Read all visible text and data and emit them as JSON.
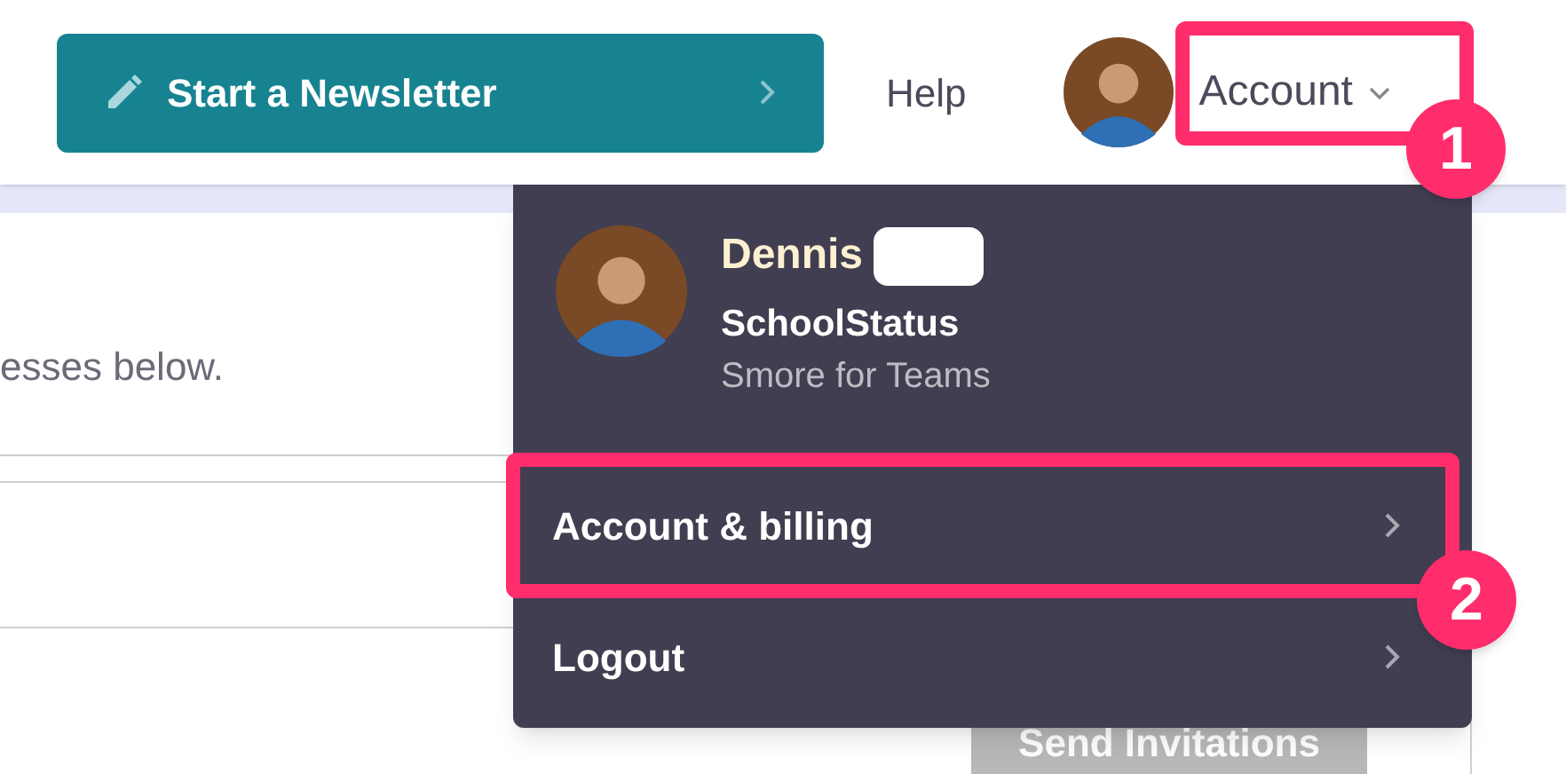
{
  "header": {
    "newsletter_button": "Start a Newsletter",
    "help_link": "Help",
    "account_menu": {
      "label": "Account",
      "expanded": true,
      "callout": "1"
    }
  },
  "page": {
    "instructions": "esses below.",
    "send_button": {
      "label": "Send Invitations",
      "disabled": true
    }
  },
  "dropdown": {
    "name": "Dennis",
    "organization": "SchoolStatus",
    "plan": "Smore for Teams",
    "items": [
      {
        "label": "Account & billing",
        "callout": "2"
      },
      {
        "label": "Logout"
      }
    ]
  }
}
